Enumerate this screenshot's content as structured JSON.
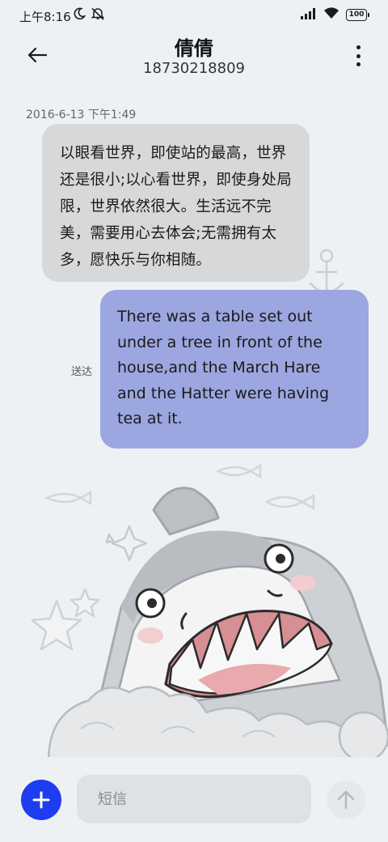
{
  "status_bar": {
    "time": "上午8:16",
    "icons": [
      "moon-icon",
      "mute-icon",
      "signal-icon",
      "wifi-icon",
      "battery-icon"
    ],
    "battery": "100"
  },
  "header": {
    "contact_name": "倩倩",
    "contact_number": "18730218809",
    "back_icon": "back-arrow-icon",
    "more_icon": "more-vertical-icon"
  },
  "conversation": {
    "timestamp": "2016-6-13 下午1:49",
    "received_message": "以眼看世界，即使站的最高，世界还是很小;以心看世界，即使身处局限，世界依然很大。生活远不完美，需要用心去体会;无需拥有太多，愿快乐与你相随。",
    "sent_message": "There was a table set out under a tree in front of the house,and the March Hare and the Hatter were having tea at it.",
    "sent_status": "送达"
  },
  "input_bar": {
    "placeholder": "短信",
    "add_icon": "plus-icon",
    "send_icon": "send-arrow-icon"
  },
  "colors": {
    "background": "#eef1f4",
    "received_bubble": "#d6d8d9",
    "sent_bubble": "#9ca6e0",
    "add_button": "#1f3df0"
  }
}
